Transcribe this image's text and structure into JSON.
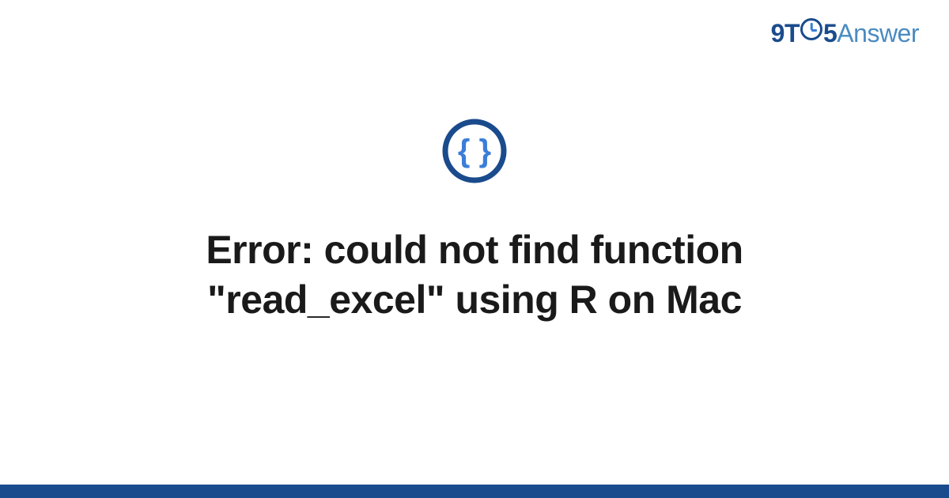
{
  "brand": {
    "part1": "9T",
    "part2": "5",
    "part3": "Answer"
  },
  "icon": {
    "name": "code-braces"
  },
  "title": "Error: could not find function \"read_excel\" using R on Mac",
  "colors": {
    "primary": "#1a4b8c",
    "accent": "#3b7dd8",
    "light_blue": "#4a8bc2"
  }
}
